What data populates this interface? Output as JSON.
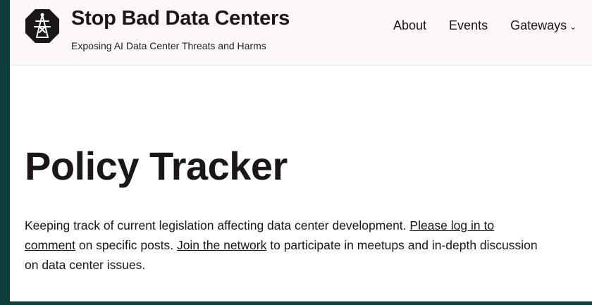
{
  "site": {
    "title": "Stop Bad Data Centers",
    "tagline": "Exposing AI Data Center Threats and Harms",
    "logo_icon": "transmission-tower-icon"
  },
  "nav": {
    "about": "About",
    "events": "Events",
    "gateways": "Gateways",
    "gateways_chevron": "⌄"
  },
  "page": {
    "title": "Policy Tracker",
    "intro_part1": "Keeping track of current legislation affecting data center development. ",
    "login_link": "Please log in to comment",
    "intro_part2": " on specific posts. ",
    "join_link": "Join the network",
    "intro_part3": " to participate in meetups and in-depth discussion on data center issues."
  },
  "colors": {
    "background": "#0f3f3c",
    "header_bg": "#fbf8f7",
    "text": "#1b1717"
  }
}
